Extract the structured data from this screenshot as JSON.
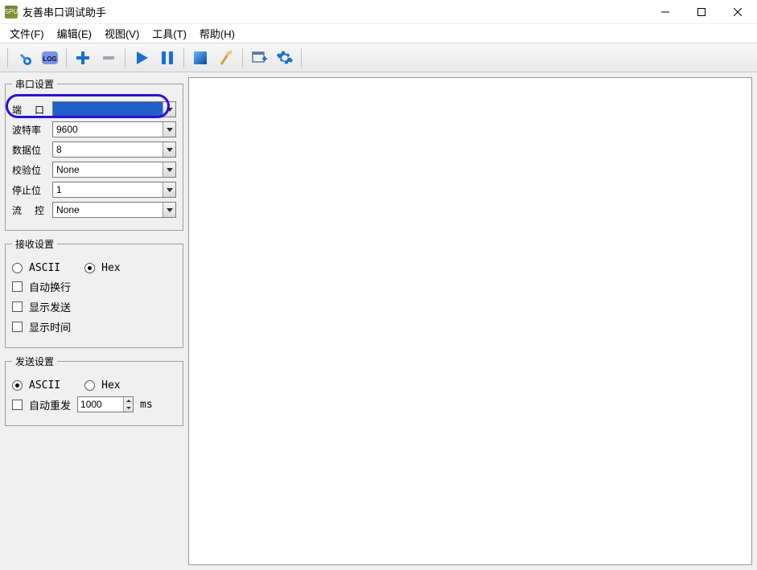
{
  "window": {
    "title": "友善串口调试助手",
    "icon_text": "SPU"
  },
  "menus": {
    "file": "文件(F)",
    "edit": "编辑(E)",
    "view": "视图(V)",
    "tools": "工具(T)",
    "help": "帮助(H)"
  },
  "groups": {
    "serial": {
      "legend": "串口设置",
      "port_label": "端　口",
      "port_value": "",
      "baud_label": "波特率",
      "baud_value": "9600",
      "databits_label": "数据位",
      "databits_value": "8",
      "parity_label": "校验位",
      "parity_value": "None",
      "stopbits_label": "停止位",
      "stopbits_value": "1",
      "flow_label": "流　控",
      "flow_value": "None"
    },
    "recv": {
      "legend": "接收设置",
      "ascii": "ASCII",
      "hex": "Hex",
      "wrap": "自动换行",
      "showsend": "显示发送",
      "showtime": "显示时间"
    },
    "send": {
      "legend": "发送设置",
      "ascii": "ASCII",
      "hex": "Hex",
      "auto": "自动重发",
      "interval": "1000",
      "unit": "ms"
    }
  }
}
